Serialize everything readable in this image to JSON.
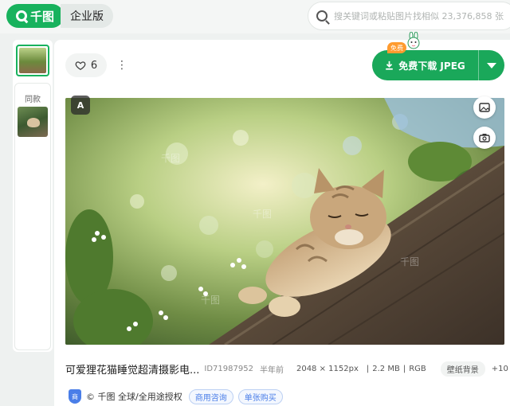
{
  "header": {
    "logo_text": "千图",
    "enterprise_label": "企业版",
    "search_placeholder": "搜关键词或粘贴图片找相似 23,376,858 张"
  },
  "rail": {
    "same_label": "同款"
  },
  "actions": {
    "like_count": "6",
    "more_label": "⋮",
    "free_badge": "免费",
    "download_label": "免费下载 JPEG"
  },
  "photo": {
    "ai_badge": "A",
    "watermark": "千图"
  },
  "info": {
    "title": "可爱狸花猫睡觉超清摄影电...",
    "id": "ID71987952",
    "time": "半年前",
    "dimensions": "2048 × 1152px",
    "size": "2.2 MB",
    "color_mode": "RGB",
    "tag": "壁纸背景",
    "more_tags": "+10"
  },
  "license": {
    "shield_text": "商",
    "text": "© 千图 全球/全用途授权",
    "chip_consult": "商用咨询",
    "chip_buy": "单张购买"
  },
  "colors": {
    "brand_green": "#18b25d",
    "download_green": "#1aa85a",
    "license_blue": "#4a7ee8",
    "free_orange": "#ff9b2f"
  }
}
